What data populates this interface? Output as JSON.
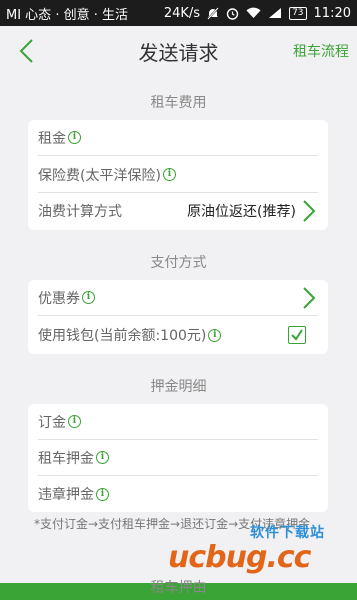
{
  "status": {
    "carrier": "MI 心态 · 创意 · 生活",
    "speed": "24K/s",
    "battery": "73",
    "time": "11:20"
  },
  "nav": {
    "title": "发送请求",
    "flow_link": "租车流程"
  },
  "sections": {
    "rent_fee": {
      "title": "租车费用",
      "rent": "租金",
      "insurance": "保险费(太平洋保险)",
      "fuel_method_label": "油费计算方式",
      "fuel_method_value": "原油位返还(推荐)"
    },
    "payment": {
      "title": "支付方式",
      "coupon": "优惠券",
      "wallet": "使用钱包(当前余额:100元)",
      "wallet_checked": true
    },
    "deposit": {
      "title": "押金明细",
      "order_deposit": "订金",
      "rental_deposit": "租车押金",
      "violation_deposit": "违章押金",
      "note": "*支付订金→支付租车押金→退还订金→支付违章押金"
    },
    "next": {
      "title": "租车押由"
    }
  },
  "watermark": {
    "logo": "ucbug.cc",
    "text": "软件下载站"
  },
  "colors": {
    "accent": "#3aa436",
    "statusbar": "#1c1c1c",
    "background": "#f1f1f3"
  }
}
